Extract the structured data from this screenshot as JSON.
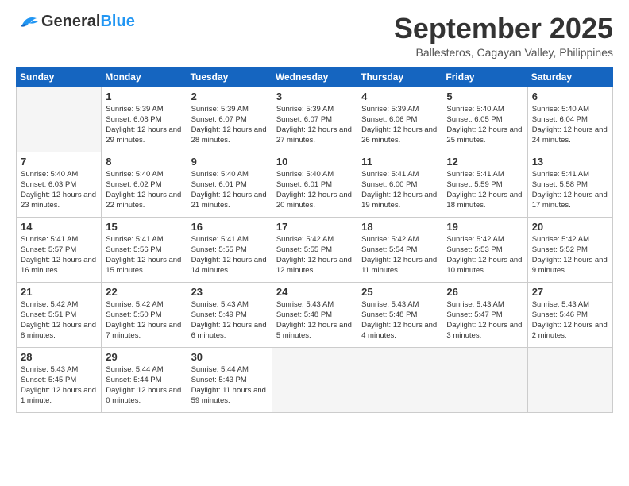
{
  "header": {
    "logo_general": "General",
    "logo_blue": "Blue",
    "month_title": "September 2025",
    "location": "Ballesteros, Cagayan Valley, Philippines"
  },
  "weekdays": [
    "Sunday",
    "Monday",
    "Tuesday",
    "Wednesday",
    "Thursday",
    "Friday",
    "Saturday"
  ],
  "weeks": [
    [
      {
        "day": "",
        "empty": true
      },
      {
        "day": "1",
        "sunrise": "5:39 AM",
        "sunset": "6:08 PM",
        "daylight": "12 hours and 29 minutes."
      },
      {
        "day": "2",
        "sunrise": "5:39 AM",
        "sunset": "6:07 PM",
        "daylight": "12 hours and 28 minutes."
      },
      {
        "day": "3",
        "sunrise": "5:39 AM",
        "sunset": "6:07 PM",
        "daylight": "12 hours and 27 minutes."
      },
      {
        "day": "4",
        "sunrise": "5:39 AM",
        "sunset": "6:06 PM",
        "daylight": "12 hours and 26 minutes."
      },
      {
        "day": "5",
        "sunrise": "5:40 AM",
        "sunset": "6:05 PM",
        "daylight": "12 hours and 25 minutes."
      },
      {
        "day": "6",
        "sunrise": "5:40 AM",
        "sunset": "6:04 PM",
        "daylight": "12 hours and 24 minutes."
      }
    ],
    [
      {
        "day": "7",
        "sunrise": "5:40 AM",
        "sunset": "6:03 PM",
        "daylight": "12 hours and 23 minutes."
      },
      {
        "day": "8",
        "sunrise": "5:40 AM",
        "sunset": "6:02 PM",
        "daylight": "12 hours and 22 minutes."
      },
      {
        "day": "9",
        "sunrise": "5:40 AM",
        "sunset": "6:01 PM",
        "daylight": "12 hours and 21 minutes."
      },
      {
        "day": "10",
        "sunrise": "5:40 AM",
        "sunset": "6:01 PM",
        "daylight": "12 hours and 20 minutes."
      },
      {
        "day": "11",
        "sunrise": "5:41 AM",
        "sunset": "6:00 PM",
        "daylight": "12 hours and 19 minutes."
      },
      {
        "day": "12",
        "sunrise": "5:41 AM",
        "sunset": "5:59 PM",
        "daylight": "12 hours and 18 minutes."
      },
      {
        "day": "13",
        "sunrise": "5:41 AM",
        "sunset": "5:58 PM",
        "daylight": "12 hours and 17 minutes."
      }
    ],
    [
      {
        "day": "14",
        "sunrise": "5:41 AM",
        "sunset": "5:57 PM",
        "daylight": "12 hours and 16 minutes."
      },
      {
        "day": "15",
        "sunrise": "5:41 AM",
        "sunset": "5:56 PM",
        "daylight": "12 hours and 15 minutes."
      },
      {
        "day": "16",
        "sunrise": "5:41 AM",
        "sunset": "5:55 PM",
        "daylight": "12 hours and 14 minutes."
      },
      {
        "day": "17",
        "sunrise": "5:42 AM",
        "sunset": "5:55 PM",
        "daylight": "12 hours and 12 minutes."
      },
      {
        "day": "18",
        "sunrise": "5:42 AM",
        "sunset": "5:54 PM",
        "daylight": "12 hours and 11 minutes."
      },
      {
        "day": "19",
        "sunrise": "5:42 AM",
        "sunset": "5:53 PM",
        "daylight": "12 hours and 10 minutes."
      },
      {
        "day": "20",
        "sunrise": "5:42 AM",
        "sunset": "5:52 PM",
        "daylight": "12 hours and 9 minutes."
      }
    ],
    [
      {
        "day": "21",
        "sunrise": "5:42 AM",
        "sunset": "5:51 PM",
        "daylight": "12 hours and 8 minutes."
      },
      {
        "day": "22",
        "sunrise": "5:42 AM",
        "sunset": "5:50 PM",
        "daylight": "12 hours and 7 minutes."
      },
      {
        "day": "23",
        "sunrise": "5:43 AM",
        "sunset": "5:49 PM",
        "daylight": "12 hours and 6 minutes."
      },
      {
        "day": "24",
        "sunrise": "5:43 AM",
        "sunset": "5:48 PM",
        "daylight": "12 hours and 5 minutes."
      },
      {
        "day": "25",
        "sunrise": "5:43 AM",
        "sunset": "5:48 PM",
        "daylight": "12 hours and 4 minutes."
      },
      {
        "day": "26",
        "sunrise": "5:43 AM",
        "sunset": "5:47 PM",
        "daylight": "12 hours and 3 minutes."
      },
      {
        "day": "27",
        "sunrise": "5:43 AM",
        "sunset": "5:46 PM",
        "daylight": "12 hours and 2 minutes."
      }
    ],
    [
      {
        "day": "28",
        "sunrise": "5:43 AM",
        "sunset": "5:45 PM",
        "daylight": "12 hours and 1 minute."
      },
      {
        "day": "29",
        "sunrise": "5:44 AM",
        "sunset": "5:44 PM",
        "daylight": "12 hours and 0 minutes."
      },
      {
        "day": "30",
        "sunrise": "5:44 AM",
        "sunset": "5:43 PM",
        "daylight": "11 hours and 59 minutes."
      },
      {
        "day": "",
        "empty": true
      },
      {
        "day": "",
        "empty": true
      },
      {
        "day": "",
        "empty": true
      },
      {
        "day": "",
        "empty": true
      }
    ]
  ]
}
